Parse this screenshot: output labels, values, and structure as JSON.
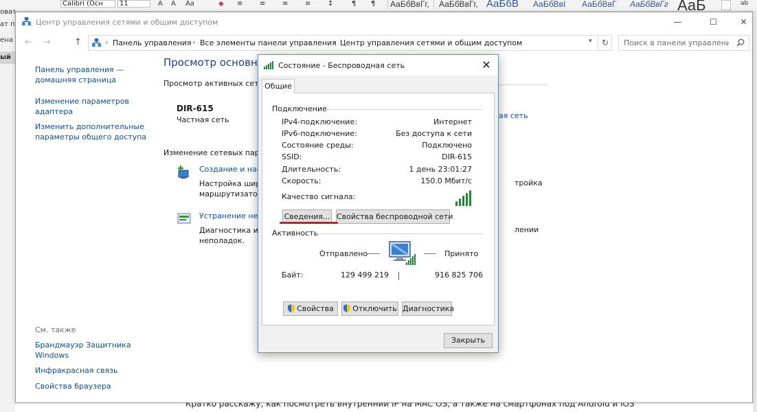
{
  "word": {
    "font_name": "Calibri (Осн",
    "font_size": "11",
    "styles": [
      "АаБбВвГг,",
      "АаБбВвГг,",
      "АаБбВ",
      "АаБбВвІ",
      "АаБбВвГ",
      "АаБбВвГг",
      "АаБ"
    ],
    "left_items": [
      "овать",
      "ат по",
      "ена",
      "ый"
    ],
    "doc_text": "Кратко расскажу, как посмотреть внутренний IP на MAC OS, а также на смартфонах под Android и iOS"
  },
  "cp": {
    "title": "Центр управления сетями и общим доступом",
    "win_min": "—",
    "win_max": "☐",
    "win_close": "✕",
    "nav_back": "←",
    "nav_forward": "→",
    "nav_up": "↑",
    "breadcrumbs": [
      "Панель управления",
      "Все элементы панели управления",
      "Центр управления сетями и общим доступом"
    ],
    "search_placeholder": "Поиск в панели управления",
    "left_nav": {
      "home": [
        "Панель управления —",
        "домашняя страница"
      ],
      "adapter": [
        "Изменение параметров",
        "адаптера"
      ],
      "sharing": [
        "Изменить дополнительные",
        "параметры общего доступа"
      ],
      "see_also": "См. также",
      "links": [
        "Брандмауэр Защитника",
        "Windows",
        "Инфракрасная связь",
        "Свойства браузера"
      ]
    },
    "main": {
      "heading": "Просмотр основных",
      "subheading": "Просмотр активных сетей",
      "network_name": "DIR-615",
      "network_type": "Частная сеть",
      "network_link_right": "ая сеть",
      "change_heading": "Изменение сетевых парам",
      "task1_link": "Создание и наст",
      "task1_desc": [
        "Настройка широ",
        "маршрутизатор"
      ],
      "task1_desc_right": "тройка",
      "task2_link": "Устранение непо",
      "task2_desc": [
        "Диагностика и и",
        "неполадок."
      ],
      "task2_desc_right": "лении"
    }
  },
  "dialog": {
    "title": "Состояние - Беспроводная сеть",
    "close": "✕",
    "tab": "Общие",
    "connection_label": "Подключение",
    "rows": [
      {
        "k": "IPv4-подключение:",
        "v": "Интернет"
      },
      {
        "k": "IPv6-подключение:",
        "v": "Без доступа к сети"
      },
      {
        "k": "Состояние среды:",
        "v": "Подключено"
      },
      {
        "k": "SSID:",
        "v": "DIR-615"
      },
      {
        "k": "Длительность:",
        "v": "1 день 23:01:27"
      },
      {
        "k": "Скорость:",
        "v": "150.0 Мбит/с"
      }
    ],
    "signal_label": "Качество сигнала:",
    "details_btn": "Сведения...",
    "wireless_props_btn": "Свойства беспроводной сети",
    "activity_label": "Активность",
    "sent_label": "Отправлено",
    "received_label": "Принято",
    "bytes_label": "Байт:",
    "bytes_sent": "129 499 219",
    "bytes_received": "916 825 706",
    "properties_btn": "Свойства",
    "disable_btn": "Отключить",
    "diagnostics_btn": "Диагностика",
    "close_btn": "Закрыть",
    "colors": {
      "signal": "#1e8b2e",
      "highlight": "#d7141f",
      "link": "#0b4ea0"
    }
  }
}
